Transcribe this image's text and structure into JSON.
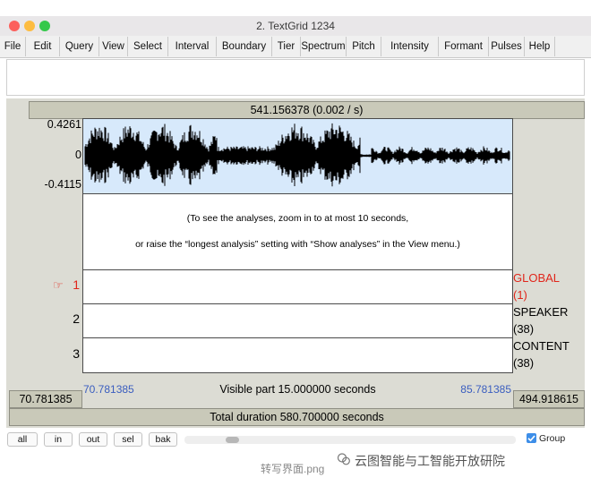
{
  "window": {
    "title": "2. TextGrid 1234",
    "traffic_lights": {
      "close": "#fc605c",
      "minimize": "#fdbc40",
      "zoom": "#34c84a"
    }
  },
  "menu": [
    {
      "label": "File"
    },
    {
      "label": "Edit"
    },
    {
      "label": "Query"
    },
    {
      "label": "View"
    },
    {
      "label": "Select"
    },
    {
      "label": "Interval"
    },
    {
      "label": "Boundary"
    },
    {
      "label": "Tier"
    },
    {
      "label": "Spectrum"
    },
    {
      "label": "Pitch"
    },
    {
      "label": "Intensity"
    },
    {
      "label": "Formant"
    },
    {
      "label": "Pulses"
    },
    {
      "label": "Help"
    }
  ],
  "editor": {
    "top_readout": "541.156378 (0.002 / s)",
    "amplitude": {
      "max": "0.4261",
      "zero": "0",
      "min": "-0.4115"
    },
    "waveform_color": "#000000",
    "waveform_bg": "#d7e9fb",
    "analysis_message": {
      "line1": "(To see the analyses, zoom in to at most 10 seconds,",
      "line2": "or raise the “longest analysis” setting with “Show analyses” in the View menu.)"
    },
    "tiers": [
      {
        "number": "1",
        "name": "GLOBAL",
        "count": "(1)",
        "selected": true,
        "color": "#e0261b",
        "pointer_icon": "☞"
      },
      {
        "number": "2",
        "name": "SPEAKER",
        "count": "(38)",
        "selected": false,
        "color": "#000000"
      },
      {
        "number": "3",
        "name": "CONTENT",
        "count": "(38)",
        "selected": false,
        "color": "#000000"
      }
    ],
    "left_time": "70.781385",
    "visible_start": "70.781385",
    "visible_label": "Visible part 15.000000 seconds",
    "visible_end": "85.781385",
    "right_time": "494.918615",
    "total_duration": "Total duration 580.700000 seconds",
    "time_link_color": "#3a5dbf"
  },
  "buttons": [
    {
      "label": "all"
    },
    {
      "label": "in"
    },
    {
      "label": "out"
    },
    {
      "label": "sel"
    },
    {
      "label": "bak"
    }
  ],
  "group": {
    "label": "Group",
    "checked": true
  },
  "caption": "转写界面.png",
  "watermark": "云图智能与工智能开放研院"
}
